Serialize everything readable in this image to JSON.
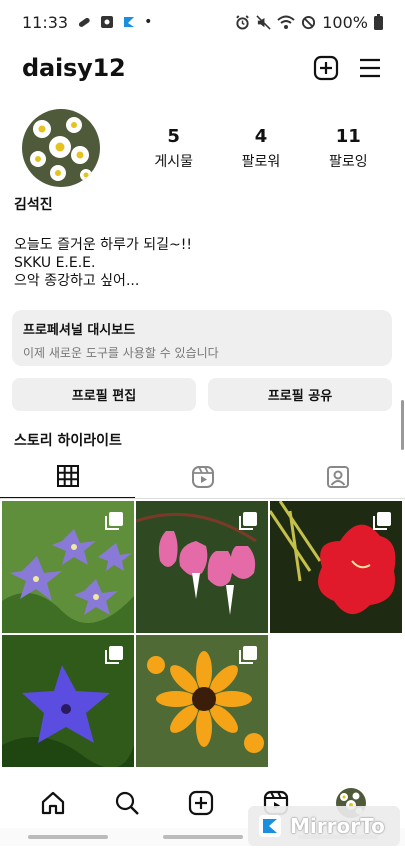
{
  "status_bar": {
    "time": "11:33",
    "battery_text": "100%",
    "icons": [
      "key-icon",
      "screenshot-icon",
      "app-icon",
      "dot-icon",
      "alarm-icon",
      "mute-icon",
      "wifi-icon",
      "blocked-icon",
      "battery-icon"
    ]
  },
  "header": {
    "username": "daisy12",
    "icons": [
      "add-post-icon",
      "menu-icon"
    ]
  },
  "profile": {
    "stats": [
      {
        "value": "5",
        "label": "게시물"
      },
      {
        "value": "4",
        "label": "팔로워"
      },
      {
        "value": "11",
        "label": "팔로잉"
      }
    ],
    "name": "김석진",
    "bio": [
      "오늘도 즐거운 하루가 되길~!!",
      "SKKU E.E.E.",
      "으악 종강하고 싶어..."
    ]
  },
  "dashboard": {
    "title": "프로페셔널 대시보드",
    "subtitle": "이제 새로운 도구를 사용할 수 있습니다"
  },
  "buttons": {
    "edit_profile": "프로필 편집",
    "share_profile": "프로필 공유"
  },
  "highlights_title": "스토리 하이라이트",
  "tabs": [
    {
      "icon": "grid-icon",
      "active": true
    },
    {
      "icon": "reels-icon",
      "active": false
    },
    {
      "icon": "tagged-icon",
      "active": false
    }
  ],
  "posts": [
    {
      "subject": "purple bellflowers",
      "multi": true
    },
    {
      "subject": "pink bleeding hearts",
      "multi": true
    },
    {
      "subject": "red amaryllis",
      "multi": true
    },
    {
      "subject": "blue bellflower",
      "multi": true
    },
    {
      "subject": "yellow black-eyed susans",
      "multi": true
    }
  ],
  "bottom_nav": [
    "home-icon",
    "search-icon",
    "create-icon",
    "reels-icon",
    "profile-avatar"
  ],
  "watermark": {
    "text": "MirrorTo"
  },
  "colors": {
    "background": "#ffffff",
    "button_bg": "#efefef",
    "text": "#111111",
    "muted": "#777777"
  }
}
